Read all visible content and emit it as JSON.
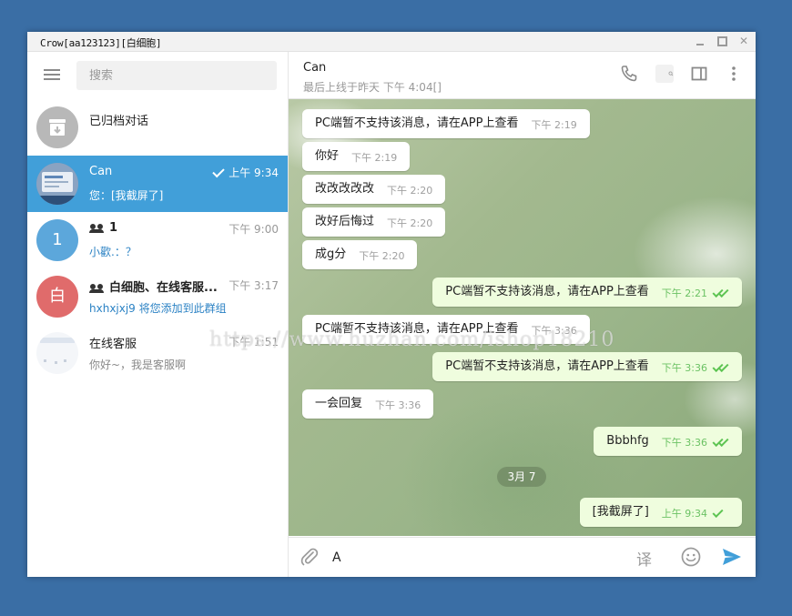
{
  "window": {
    "title": "Crow[aa123123][白细胞]"
  },
  "sidebar": {
    "search_placeholder": "搜索",
    "archived_label": "已归档对话",
    "chats": [
      {
        "name": "Can",
        "time": "上午 9:34",
        "preview": "您：[我截屏了]",
        "active": true,
        "read_check": true
      },
      {
        "name": "1",
        "time": "下午 9:00",
        "preview": "小歡.：？",
        "avatar_letter": "1",
        "avatar_color": "#5ca7db",
        "group": true
      },
      {
        "name": "白细胞、在线客服...",
        "time": "下午 3:17",
        "preview": "hxhxjxj9 将您添加到此群组",
        "avatar_letter": "白",
        "avatar_color": "#e06b6b",
        "group": true
      },
      {
        "name": "在线客服",
        "time": "下午 1:51",
        "preview": "你好~，我是客服啊"
      }
    ]
  },
  "header": {
    "name": "Can",
    "status": "最后上线于昨天 下午 4:04[]"
  },
  "messages": [
    {
      "text": "PC端暂不支持该消息，请在APP上查看",
      "time": "下午 2:19",
      "dir": "in"
    },
    {
      "text": "你好",
      "time": "下午 2:19",
      "dir": "in"
    },
    {
      "text": "改改改改改",
      "time": "下午 2:20",
      "dir": "in"
    },
    {
      "text": "改好后悔过",
      "time": "下午 2:20",
      "dir": "in"
    },
    {
      "text": "成g分",
      "time": "下午 2:20",
      "dir": "in"
    },
    {
      "text": "PC端暂不支持该消息，请在APP上查看",
      "time": "下午 2:21",
      "dir": "out",
      "ticks": 2
    },
    {
      "text": "PC端暂不支持该消息，请在APP上查看",
      "time": "下午 3:36",
      "dir": "in"
    },
    {
      "text": "PC端暂不支持该消息，请在APP上查看",
      "time": "下午 3:36",
      "dir": "out",
      "ticks": 2
    },
    {
      "text": "一会回复",
      "time": "下午 3:36",
      "dir": "in"
    },
    {
      "text": "Bbbhfg",
      "time": "下午 3:36",
      "dir": "out",
      "ticks": 2
    },
    {
      "text": "[我截屏了]",
      "time": "上午 9:34",
      "dir": "out",
      "ticks": 1
    }
  ],
  "date_separator": "3月 7",
  "composer": {
    "value": "A",
    "translate_label": "译"
  },
  "watermark": "https://www.huzhan.com/ishop18210",
  "colors": {
    "accent": "#419fd9",
    "outgoing_bubble": "#effdde",
    "desktop": "#3a6ea5"
  }
}
